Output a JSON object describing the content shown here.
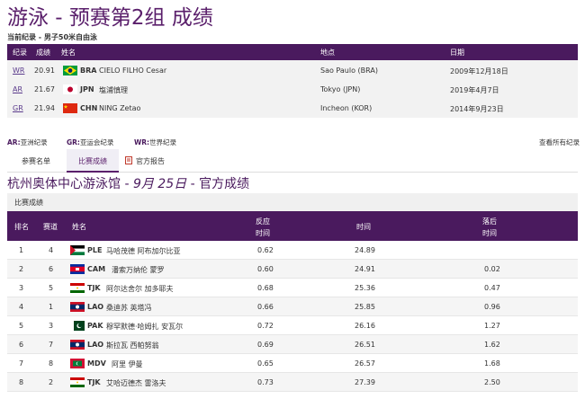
{
  "page": {
    "title": "游泳 - 预赛第2组 成绩",
    "subtitle": "当前纪录 - 男子50米自由泳"
  },
  "records": {
    "headers": {
      "record": "纪录",
      "result": "成绩",
      "name": "姓名",
      "venue": "地点",
      "date": "日期"
    },
    "rows": [
      {
        "code": "WR",
        "result": "20.91",
        "noc": "BRA",
        "name": "CIELO FILHO Cesar",
        "venue": "Sao Paulo (BRA)",
        "date": "2009年12月18日",
        "flag": "BRA"
      },
      {
        "code": "AR",
        "result": "21.67",
        "noc": "JPN",
        "name": "塩浦慎理",
        "venue": "Tokyo (JPN)",
        "date": "2019年4月7日",
        "flag": "JPN"
      },
      {
        "code": "GR",
        "result": "21.94",
        "noc": "CHN",
        "name": "NING Zetao",
        "venue": "Incheon (KOR)",
        "date": "2014年9月23日",
        "flag": "CHN"
      }
    ]
  },
  "legend": {
    "ar_code": "AR:",
    "ar_text": "亚洲纪录",
    "gr_code": "GR:",
    "gr_text": "亚运会纪录",
    "wr_code": "WR:",
    "wr_text": "世界纪录",
    "view_all": "查看所有纪录"
  },
  "tabs": {
    "entry_list": "参赛名单",
    "results": "比赛成绩",
    "official_report": "官方报告"
  },
  "venue": {
    "prefix": "杭州奥体中心游泳馆 - ",
    "date": "9月 25日",
    "suffix": " - 官方成绩"
  },
  "section_label": "比赛成绩",
  "results": {
    "headers": {
      "rank": "排名",
      "lane": "赛道",
      "name": "姓名",
      "reaction_1": "反应",
      "reaction_2": "时间",
      "time": "时间",
      "behind_1": "落后",
      "behind_2": "时间"
    },
    "rows": [
      {
        "rank": "1",
        "lane": "4",
        "noc": "PLE",
        "name": "马哈茂德 阿布加尔比亚",
        "reaction": "0.62",
        "time": "24.89",
        "behind": "",
        "flag": "PLE"
      },
      {
        "rank": "2",
        "lane": "6",
        "noc": "CAM",
        "name": "潘索万纳伦 蒙罗",
        "reaction": "0.60",
        "time": "24.91",
        "behind": "0.02",
        "flag": "CAM"
      },
      {
        "rank": "3",
        "lane": "5",
        "noc": "TJK",
        "name": "阿尔达舍尔 加多耶夫",
        "reaction": "0.68",
        "time": "25.36",
        "behind": "0.47",
        "flag": "TJK"
      },
      {
        "rank": "4",
        "lane": "1",
        "noc": "LAO",
        "name": "桑迪苏 英塔冯",
        "reaction": "0.66",
        "time": "25.85",
        "behind": "0.96",
        "flag": "LAO"
      },
      {
        "rank": "5",
        "lane": "3",
        "noc": "PAK",
        "name": "穆罕默德·哈姆扎 安瓦尔",
        "reaction": "0.72",
        "time": "26.16",
        "behind": "1.27",
        "flag": "PAK"
      },
      {
        "rank": "6",
        "lane": "7",
        "noc": "LAO",
        "name": "斯拉瓦 西帕努翁",
        "reaction": "0.69",
        "time": "26.51",
        "behind": "1.62",
        "flag": "LAO"
      },
      {
        "rank": "7",
        "lane": "8",
        "noc": "MDV",
        "name": "阿里 伊曼",
        "reaction": "0.65",
        "time": "26.57",
        "behind": "1.68",
        "flag": "MDV"
      },
      {
        "rank": "8",
        "lane": "2",
        "noc": "TJK",
        "name": "艾哈迈德杰 雷洛夫",
        "reaction": "0.73",
        "time": "27.39",
        "behind": "2.50",
        "flag": "TJK"
      }
    ]
  },
  "colors": {
    "header_bg": "#4a1a5e",
    "accent": "#5a1f6b"
  }
}
